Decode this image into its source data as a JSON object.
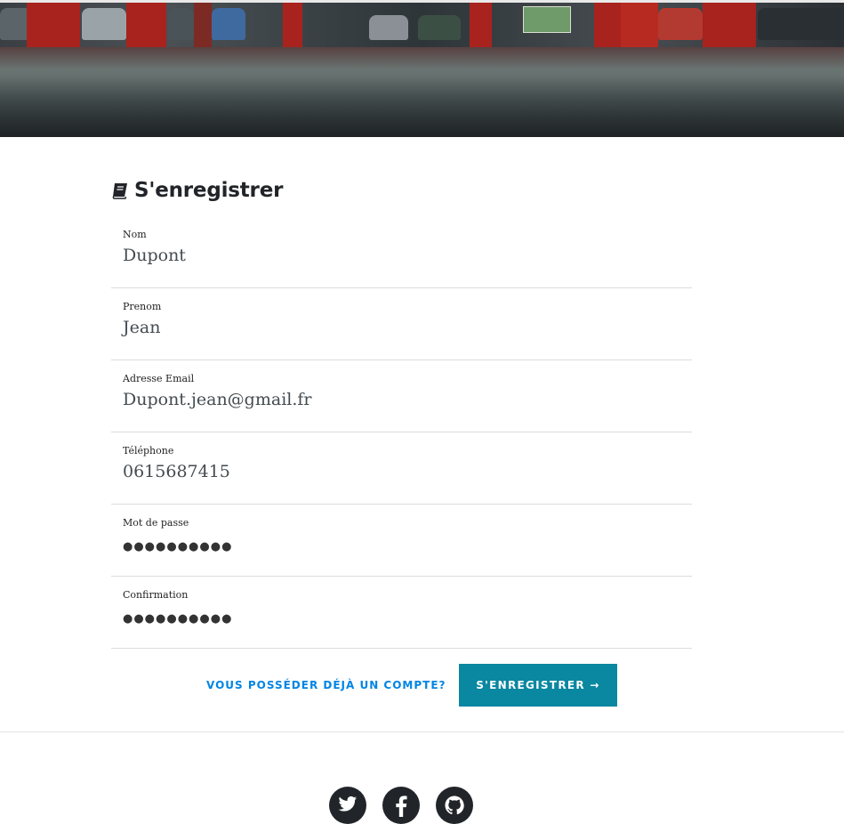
{
  "header": {
    "image_icon": "parking-garage-photo"
  },
  "form": {
    "title": "S'enregistrer",
    "title_icon": "book-icon",
    "fields": [
      {
        "label": "Nom",
        "value": "Dupont"
      },
      {
        "label": "Prenom",
        "value": "Jean"
      },
      {
        "label": "Adresse Email",
        "value": "Dupont.jean@gmail.fr"
      },
      {
        "label": "Téléphone",
        "value": "0615687415"
      },
      {
        "label": "Mot de passe",
        "value": "●●●●●●●●●●"
      },
      {
        "label": "Confirmation",
        "value": "●●●●●●●●●●"
      }
    ],
    "login_link": "Vous posséder déjà un compte?",
    "submit_label": "S'enregistrer →"
  },
  "footer": {
    "socials": [
      {
        "icon": "twitter-icon"
      },
      {
        "icon": "facebook-icon"
      },
      {
        "icon": "github-icon"
      }
    ]
  },
  "colors": {
    "accent_button": "#0a87a1",
    "link": "#0085e3",
    "dark": "#212529"
  }
}
